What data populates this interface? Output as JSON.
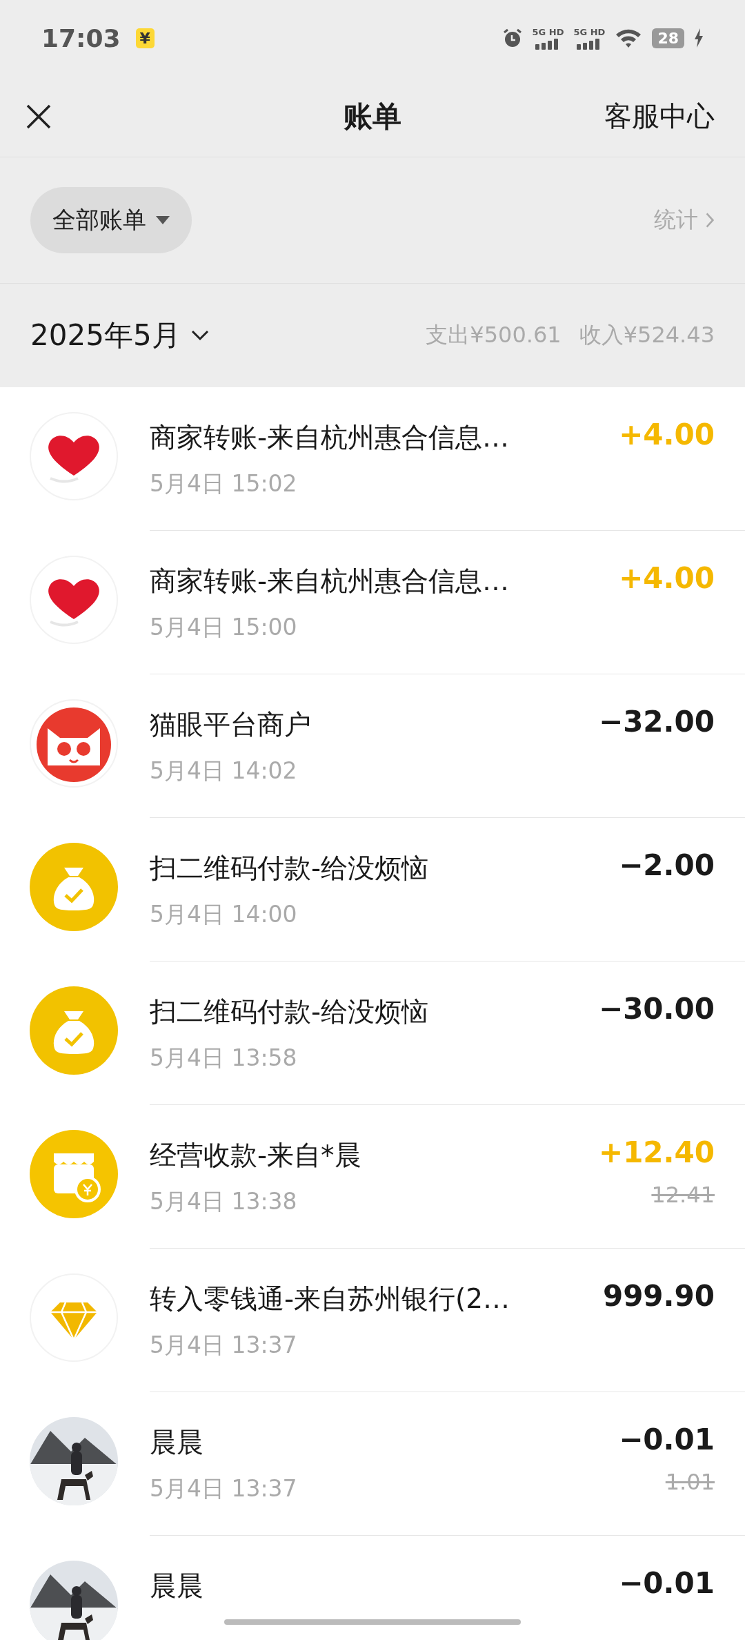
{
  "status_bar": {
    "time": "17:03",
    "badge": "¥",
    "signal_labels": [
      "5G HD",
      "5G HD"
    ],
    "battery": "28"
  },
  "header": {
    "title": "账单",
    "action": "客服中心"
  },
  "filter": {
    "label": "全部账单",
    "stats": "统计"
  },
  "month": {
    "label": "2025年5月",
    "expense": "支出¥500.61",
    "income": "收入¥524.43"
  },
  "transactions": [
    {
      "kind": "heart",
      "title": "商家转账-来自杭州惠合信息…",
      "time": "5月4日 15:02",
      "amount": "+4.00",
      "income": true
    },
    {
      "kind": "heart",
      "title": "商家转账-来自杭州惠合信息…",
      "time": "5月4日 15:00",
      "amount": "+4.00",
      "income": true
    },
    {
      "kind": "cat",
      "title": "猫眼平台商户",
      "time": "5月4日 14:02",
      "amount": "−32.00",
      "income": false
    },
    {
      "kind": "bag",
      "title": "扫二维码付款-给没烦恼",
      "time": "5月4日 14:00",
      "amount": "−2.00",
      "income": false
    },
    {
      "kind": "bag",
      "title": "扫二维码付款-给没烦恼",
      "time": "5月4日 13:58",
      "amount": "−30.00",
      "income": false
    },
    {
      "kind": "store",
      "title": "经营收款-来自*晨",
      "time": "5月4日 13:38",
      "amount": "+12.40",
      "income": true,
      "original_amount": "12.41"
    },
    {
      "kind": "diamond",
      "title": "转入零钱通-来自苏州银行(2…",
      "time": "5月4日 13:37",
      "amount": "999.90",
      "income": false
    },
    {
      "kind": "picture",
      "title": "晨晨",
      "time": "5月4日 13:37",
      "amount": "−0.01",
      "income": false,
      "original_amount": "1.01"
    },
    {
      "kind": "picture",
      "title": "晨晨",
      "amount": "−0.01",
      "income": false
    }
  ]
}
